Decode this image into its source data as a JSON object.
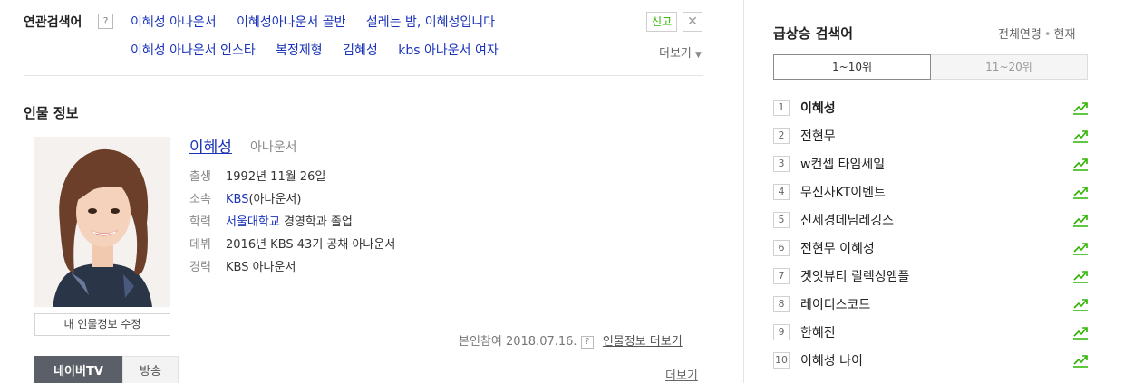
{
  "related": {
    "title": "연관검색어",
    "help": "?",
    "row1": [
      "이혜성 아나운서",
      "이혜성아나운서 골반",
      "설레는 밤, 이혜성입니다"
    ],
    "row2": [
      "이혜성 아나운서 인스타",
      "복정제형",
      "김혜성",
      "kbs 아나운서 여자"
    ],
    "report": "신고",
    "close": "✕",
    "more": "더보기"
  },
  "person": {
    "section_title": "인물 정보",
    "name": "이혜성",
    "job": "아나운서",
    "info": [
      {
        "label": "출생",
        "value": "1992년 11월 26일"
      },
      {
        "label": "소속",
        "link": "KBS",
        "value": "(아나운서)"
      },
      {
        "label": "학력",
        "link": "서울대학교",
        "value": " 경영학과 졸업"
      },
      {
        "label": "데뷔",
        "value": "2016년 KBS 43기 공채 아나운서"
      },
      {
        "label": "경력",
        "value": "KBS 아나운서"
      }
    ],
    "edit_button": "내 인물정보 수정",
    "footer_prefix": "본인참여 2018.07.16.",
    "footer_help": "?",
    "footer_more": "인물정보 더보기"
  },
  "tabs": {
    "naver_tv": "네이버TV",
    "broadcast": "방송",
    "more": "더보기"
  },
  "trending": {
    "title": "급상승 검색어",
    "filter_all": "전체연령",
    "filter_sep": "•",
    "filter_now": "현재",
    "tab_active": "1~10위",
    "tab_inactive": "11~20위",
    "items": [
      {
        "rank": "1",
        "keyword": "이혜성"
      },
      {
        "rank": "2",
        "keyword": "전현무"
      },
      {
        "rank": "3",
        "keyword": "w컨셉 타임세일"
      },
      {
        "rank": "4",
        "keyword": "무신사KT이벤트"
      },
      {
        "rank": "5",
        "keyword": "신세경데님레깅스"
      },
      {
        "rank": "6",
        "keyword": "전현무 이혜성"
      },
      {
        "rank": "7",
        "keyword": "겟잇뷰티 릴렉싱앰플"
      },
      {
        "rank": "8",
        "keyword": "레이디스코드"
      },
      {
        "rank": "9",
        "keyword": "한혜진"
      },
      {
        "rank": "10",
        "keyword": "이혜성 나이"
      }
    ],
    "up_color": "#2db400"
  }
}
